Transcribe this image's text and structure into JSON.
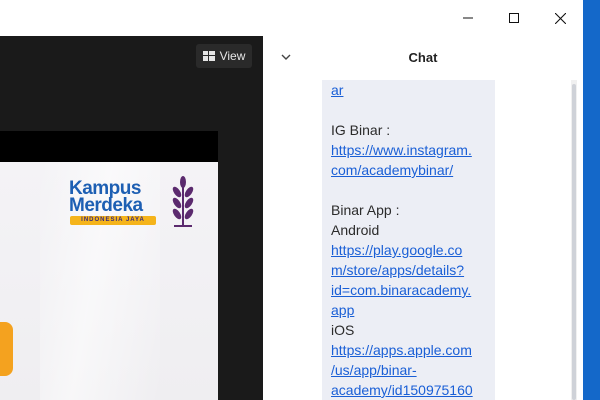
{
  "window": {
    "controls": {
      "minimize_icon": "minimize-icon",
      "maximize_icon": "maximize-icon",
      "close_icon": "close-icon"
    }
  },
  "meeting": {
    "view_label": "View",
    "slide": {
      "logo_line1": "Kampus",
      "logo_line2": "Merdeka",
      "logo_tagline": "INDONESIA JAYA"
    }
  },
  "chat": {
    "title": "Chat",
    "message_lines": [
      {
        "text": "ar",
        "link": true
      },
      {
        "text": "",
        "link": false
      },
      {
        "text": "IG Binar :",
        "link": false
      },
      {
        "text": "https://www.instagram.",
        "link": true
      },
      {
        "text": "com/academybinar/",
        "link": true
      },
      {
        "text": "",
        "link": false
      },
      {
        "text": "Binar App :",
        "link": false
      },
      {
        "text": "Android",
        "link": false
      },
      {
        "text": "https://play.google.co",
        "link": true
      },
      {
        "text": "m/store/apps/details?",
        "link": true
      },
      {
        "text": "id=com.binaracademy.",
        "link": true
      },
      {
        "text": "app",
        "link": true
      },
      {
        "text": "iOS",
        "link": false
      },
      {
        "text": "https://apps.apple.com",
        "link": true
      },
      {
        "text": "/us/app/binar-",
        "link": true
      },
      {
        "text": "academy/id150975160",
        "link": true
      }
    ]
  },
  "colors": {
    "desktop": "#1468c9",
    "meeting_bg": "#1a1a1a",
    "link": "#1a5fd6",
    "bubble": "#eceef5",
    "accent_orange": "#f4a21f"
  }
}
